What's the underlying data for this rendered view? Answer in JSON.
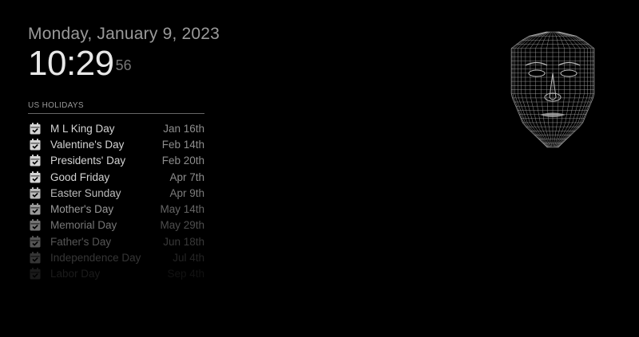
{
  "clock": {
    "date": "Monday, January 9, 2023",
    "time": "10:29",
    "seconds": "56"
  },
  "calendar": {
    "header": "US Holidays",
    "icon": "calendar-check-icon",
    "events": [
      {
        "title": "M L King Day",
        "date": "Jan 16th",
        "opacity": 1.0
      },
      {
        "title": "Valentine's Day",
        "date": "Feb 14th",
        "opacity": 1.0
      },
      {
        "title": "Presidents' Day",
        "date": "Feb 20th",
        "opacity": 1.0
      },
      {
        "title": "Good Friday",
        "date": "Apr 7th",
        "opacity": 1.0
      },
      {
        "title": "Easter Sunday",
        "date": "Apr 9th",
        "opacity": 0.88
      },
      {
        "title": "Mother's Day",
        "date": "May 14th",
        "opacity": 0.72
      },
      {
        "title": "Memorial Day",
        "date": "May 29th",
        "opacity": 0.55
      },
      {
        "title": "Father's Day",
        "date": "Jun 18th",
        "opacity": 0.4
      },
      {
        "title": "Independence Day",
        "date": "Jul 4th",
        "opacity": 0.25
      },
      {
        "title": "Labor Day",
        "date": "Sep 4th",
        "opacity": 0.12
      }
    ]
  },
  "face_widget": {
    "icon": "wireframe-face-icon",
    "color": "#bdbdbd"
  }
}
